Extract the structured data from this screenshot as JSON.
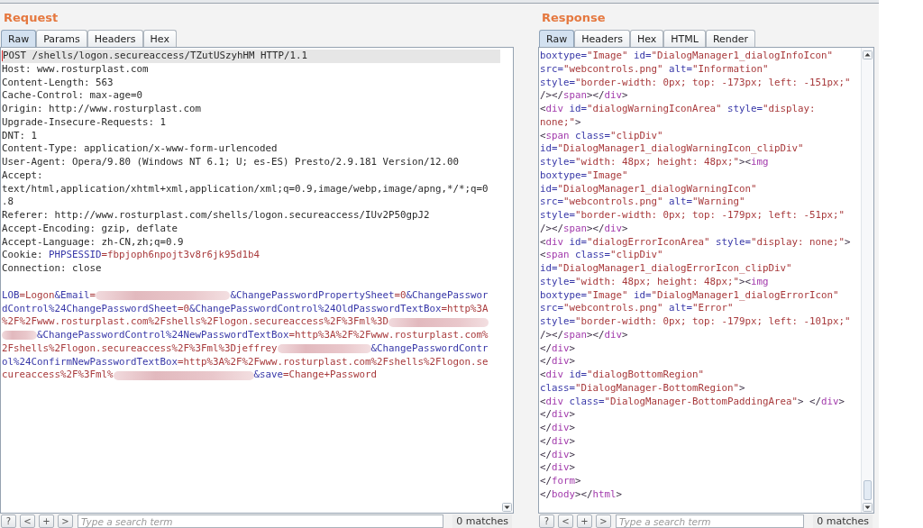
{
  "request": {
    "title": "Request",
    "tabs": [
      {
        "label": "Raw",
        "selected": true
      },
      {
        "label": "Params",
        "selected": false
      },
      {
        "label": "Headers",
        "selected": false
      },
      {
        "label": "Hex",
        "selected": false
      }
    ],
    "request_line": {
      "text": "POST /shells/logon.secureaccess/TZutUSzyhHM HTTP/1.1",
      "highlighted": true
    },
    "headers": [
      {
        "name": "Host:",
        "value": [
          {
            "kind": "plain",
            "text": "www.rosturplast.com"
          }
        ]
      },
      {
        "name": "Content-Length:",
        "value": [
          {
            "kind": "plain",
            "text": "563"
          }
        ]
      },
      {
        "name": "Cache-Control:",
        "value": [
          {
            "kind": "plain",
            "text": "max-age=0"
          }
        ]
      },
      {
        "name": "Origin:",
        "value": [
          {
            "kind": "plain",
            "text": "http://www.rosturplast.com"
          }
        ]
      },
      {
        "name": "Upgrade-Insecure-Requests:",
        "value": [
          {
            "kind": "plain",
            "text": "1"
          }
        ]
      },
      {
        "name": "DNT:",
        "value": [
          {
            "kind": "plain",
            "text": "1"
          }
        ]
      },
      {
        "name": "Content-Type:",
        "value": [
          {
            "kind": "plain",
            "text": "application/x-www-form-urlencoded"
          }
        ]
      },
      {
        "name": "User-Agent:",
        "value": [
          {
            "kind": "plain",
            "text": "Opera/9.80 (Windows NT 6.1; U; es-ES) Presto/2.9.181 Version/12.00"
          }
        ]
      },
      {
        "name": "Accept:",
        "value": [
          {
            "kind": "plain",
            "text": "text/html,application/xhtml+xml,application/xml;q=0.9,image/webp,image/apng,*/*;q=0.8"
          }
        ]
      },
      {
        "name": "Referer:",
        "value": [
          {
            "kind": "plain",
            "text": "http://www.rosturplast.com/shells/logon.secureaccess/IUv2P50gpJ2"
          }
        ]
      },
      {
        "name": "Accept-Encoding:",
        "value": [
          {
            "kind": "plain",
            "text": "gzip, deflate"
          }
        ]
      },
      {
        "name": "Accept-Language:",
        "value": [
          {
            "kind": "plain",
            "text": "zh-CN,zh;q=0.9"
          }
        ]
      },
      {
        "name": "Cookie:",
        "value": [
          {
            "kind": "name",
            "text": "PHPSESSID"
          },
          {
            "kind": "value",
            "text": "=fbpjoph6npojt3v8r6jk95d1b4"
          }
        ]
      },
      {
        "name": "Connection:",
        "value": [
          {
            "kind": "plain",
            "text": "close"
          }
        ]
      }
    ],
    "body": [
      [
        {
          "kind": "text",
          "tokens": [
            {
              "kind": "name",
              "text": "LOB"
            },
            {
              "kind": "value",
              "text": "=Logon"
            },
            {
              "kind": "name",
              "text": "&Email"
            },
            {
              "kind": "value",
              "text": "="
            }
          ]
        },
        {
          "kind": "redacted"
        },
        {
          "kind": "text",
          "tokens": [
            {
              "kind": "name",
              "text": "&ChangePasswordPropertySheet"
            },
            {
              "kind": "value",
              "text": "=0"
            },
            {
              "kind": "name",
              "text": "&ChangePasswor"
            }
          ]
        }
      ],
      [
        {
          "kind": "text",
          "tokens": [
            {
              "kind": "name",
              "text": "dControl%24ChangePasswordSheet"
            },
            {
              "kind": "value",
              "text": "=0"
            },
            {
              "kind": "name",
              "text": "&ChangePasswordControl%24OldPasswordTextBox"
            },
            {
              "kind": "value",
              "text": "=http%3A"
            }
          ]
        }
      ],
      [
        {
          "kind": "text",
          "tokens": [
            {
              "kind": "value",
              "text": "%2F%2Fwww.rosturplast.com%2Fshells%2Flogon.secureaccess%2F%3Fml%3D"
            }
          ]
        },
        {
          "kind": "redacted"
        }
      ],
      [
        {
          "kind": "redacted"
        },
        {
          "kind": "text",
          "tokens": [
            {
              "kind": "name",
              "text": "&ChangePasswordControl%24NewPasswordTextBox"
            },
            {
              "kind": "value",
              "text": "=http%3A%2F%2Fwww.rosturplast.com%"
            }
          ]
        }
      ],
      [
        {
          "kind": "text",
          "tokens": [
            {
              "kind": "value",
              "text": "2Fshells%2Flogon.secureaccess%2F%3Fml%3Djeffrey"
            }
          ]
        },
        {
          "kind": "redacted"
        },
        {
          "kind": "text",
          "tokens": [
            {
              "kind": "name",
              "text": "&ChangePasswordContr"
            }
          ]
        }
      ],
      [
        {
          "kind": "text",
          "tokens": [
            {
              "kind": "name",
              "text": "ol%24ConfirmNewPasswordTextBox"
            },
            {
              "kind": "value",
              "text": "=http%3A%2F%2Fwww.rosturplast.com%2Fshells%2Flogon.se"
            }
          ]
        }
      ],
      [
        {
          "kind": "text",
          "tokens": [
            {
              "kind": "value",
              "text": "cureaccess%2F%3Fml%"
            }
          ]
        },
        {
          "kind": "redacted"
        },
        {
          "kind": "text",
          "tokens": [
            {
              "kind": "name",
              "text": "&save"
            },
            {
              "kind": "value",
              "text": "=Change+Password"
            }
          ]
        }
      ]
    ],
    "search": {
      "buttons": [
        "?",
        "<",
        "+",
        ">"
      ],
      "placeholder": "Type a search term",
      "matches": "0 matches"
    }
  },
  "response": {
    "title": "Response",
    "tabs": [
      {
        "label": "Raw",
        "selected": true
      },
      {
        "label": "Headers",
        "selected": false
      },
      {
        "label": "Hex",
        "selected": false
      },
      {
        "label": "HTML",
        "selected": false
      },
      {
        "label": "Render",
        "selected": false
      }
    ],
    "lines": [
      [
        {
          "kind": "attr",
          "text": "boxtype="
        },
        {
          "kind": "value",
          "text": "\"Image\""
        },
        {
          "kind": "attr",
          "text": " id="
        },
        {
          "kind": "value",
          "text": "\"DialogManager1_dialogInfoIcon\""
        }
      ],
      [
        {
          "kind": "attr",
          "text": "src="
        },
        {
          "kind": "value",
          "text": "\"webcontrols.png\""
        },
        {
          "kind": "attr",
          "text": " alt="
        },
        {
          "kind": "value",
          "text": "\"Information\""
        }
      ],
      [
        {
          "kind": "attr",
          "text": "style="
        },
        {
          "kind": "value",
          "text": "\"border-width: 0px; top: -173px; left: -151px;\""
        }
      ],
      [
        {
          "kind": "punct",
          "text": "/></"
        },
        {
          "kind": "tag",
          "text": "span"
        },
        {
          "kind": "punct",
          "text": "></"
        },
        {
          "kind": "tag",
          "text": "div"
        },
        {
          "kind": "punct",
          "text": ">"
        }
      ],
      [
        {
          "kind": "punct",
          "text": "<"
        },
        {
          "kind": "tag",
          "text": "div"
        },
        {
          "kind": "attr",
          "text": " id="
        },
        {
          "kind": "value",
          "text": "\"dialogWarningIconArea\""
        },
        {
          "kind": "attr",
          "text": " style="
        },
        {
          "kind": "value",
          "text": "\"display:"
        }
      ],
      [
        {
          "kind": "value",
          "text": "none;\""
        },
        {
          "kind": "punct",
          "text": ">"
        }
      ],
      [
        {
          "kind": "punct",
          "text": "<"
        },
        {
          "kind": "tag",
          "text": "span"
        },
        {
          "kind": "attr",
          "text": " class="
        },
        {
          "kind": "value",
          "text": "\"clipDiv\""
        }
      ],
      [
        {
          "kind": "attr",
          "text": "id="
        },
        {
          "kind": "value",
          "text": "\"DialogManager1_dialogWarningIcon_clipDiv\""
        }
      ],
      [
        {
          "kind": "attr",
          "text": "style="
        },
        {
          "kind": "value",
          "text": "\"width: 48px; height: 48px;\""
        },
        {
          "kind": "punct",
          "text": "><"
        },
        {
          "kind": "tag",
          "text": "img"
        }
      ],
      [
        {
          "kind": "attr",
          "text": "boxtype="
        },
        {
          "kind": "value",
          "text": "\"Image\""
        }
      ],
      [
        {
          "kind": "attr",
          "text": "id="
        },
        {
          "kind": "value",
          "text": "\"DialogManager1_dialogWarningIcon\""
        }
      ],
      [
        {
          "kind": "attr",
          "text": "src="
        },
        {
          "kind": "value",
          "text": "\"webcontrols.png\""
        },
        {
          "kind": "attr",
          "text": " alt="
        },
        {
          "kind": "value",
          "text": "\"Warning\""
        }
      ],
      [
        {
          "kind": "attr",
          "text": "style="
        },
        {
          "kind": "value",
          "text": "\"border-width: 0px; top: -179px; left: -51px;\""
        }
      ],
      [
        {
          "kind": "punct",
          "text": "/></"
        },
        {
          "kind": "tag",
          "text": "span"
        },
        {
          "kind": "punct",
          "text": "></"
        },
        {
          "kind": "tag",
          "text": "div"
        },
        {
          "kind": "punct",
          "text": ">"
        }
      ],
      [
        {
          "kind": "punct",
          "text": "<"
        },
        {
          "kind": "tag",
          "text": "div"
        },
        {
          "kind": "attr",
          "text": " id="
        },
        {
          "kind": "value",
          "text": "\"dialogErrorIconArea\""
        },
        {
          "kind": "attr",
          "text": " style="
        },
        {
          "kind": "value",
          "text": "\"display: none;\""
        },
        {
          "kind": "punct",
          "text": ">"
        }
      ],
      [
        {
          "kind": "punct",
          "text": "<"
        },
        {
          "kind": "tag",
          "text": "span"
        },
        {
          "kind": "attr",
          "text": " class="
        },
        {
          "kind": "value",
          "text": "\"clipDiv\""
        }
      ],
      [
        {
          "kind": "attr",
          "text": "id="
        },
        {
          "kind": "value",
          "text": "\"DialogManager1_dialogErrorIcon_clipDiv\""
        }
      ],
      [
        {
          "kind": "attr",
          "text": "style="
        },
        {
          "kind": "value",
          "text": "\"width: 48px; height: 48px;\""
        },
        {
          "kind": "punct",
          "text": "><"
        },
        {
          "kind": "tag",
          "text": "img"
        }
      ],
      [
        {
          "kind": "attr",
          "text": "boxtype="
        },
        {
          "kind": "value",
          "text": "\"Image\""
        },
        {
          "kind": "attr",
          "text": " id="
        },
        {
          "kind": "value",
          "text": "\"DialogManager1_dialogErrorIcon\""
        }
      ],
      [
        {
          "kind": "attr",
          "text": "src="
        },
        {
          "kind": "value",
          "text": "\"webcontrols.png\""
        },
        {
          "kind": "attr",
          "text": " alt="
        },
        {
          "kind": "value",
          "text": "\"Error\""
        }
      ],
      [
        {
          "kind": "attr",
          "text": "style="
        },
        {
          "kind": "value",
          "text": "\"border-width: 0px; top: -179px; left: -101px;\""
        }
      ],
      [
        {
          "kind": "punct",
          "text": "/></"
        },
        {
          "kind": "tag",
          "text": "span"
        },
        {
          "kind": "punct",
          "text": "></"
        },
        {
          "kind": "tag",
          "text": "div"
        },
        {
          "kind": "punct",
          "text": ">"
        }
      ],
      [
        {
          "kind": "punct",
          "text": "</"
        },
        {
          "kind": "tag",
          "text": "div"
        },
        {
          "kind": "punct",
          "text": ">"
        }
      ],
      [
        {
          "kind": "punct",
          "text": "</"
        },
        {
          "kind": "tag",
          "text": "div"
        },
        {
          "kind": "punct",
          "text": ">"
        }
      ],
      [
        {
          "kind": "punct",
          "text": "<"
        },
        {
          "kind": "tag",
          "text": "div"
        },
        {
          "kind": "attr",
          "text": " id="
        },
        {
          "kind": "value",
          "text": "\"dialogBottomRegion\""
        }
      ],
      [
        {
          "kind": "attr",
          "text": "class="
        },
        {
          "kind": "value",
          "text": "\"DialogManager-BottomRegion\""
        },
        {
          "kind": "punct",
          "text": ">"
        }
      ],
      [
        {
          "kind": "punct",
          "text": "<"
        },
        {
          "kind": "tag",
          "text": "div"
        },
        {
          "kind": "attr",
          "text": " class="
        },
        {
          "kind": "value",
          "text": "\"DialogManager-BottomPaddingArea\""
        },
        {
          "kind": "punct",
          "text": "> </"
        },
        {
          "kind": "tag",
          "text": "div"
        },
        {
          "kind": "punct",
          "text": ">"
        }
      ],
      [
        {
          "kind": "punct",
          "text": "</"
        },
        {
          "kind": "tag",
          "text": "div"
        },
        {
          "kind": "punct",
          "text": ">"
        }
      ],
      [
        {
          "kind": "punct",
          "text": "</"
        },
        {
          "kind": "tag",
          "text": "div"
        },
        {
          "kind": "punct",
          "text": ">"
        }
      ],
      [
        {
          "kind": "punct",
          "text": "</"
        },
        {
          "kind": "tag",
          "text": "div"
        },
        {
          "kind": "punct",
          "text": ">"
        }
      ],
      [
        {
          "kind": "punct",
          "text": "</"
        },
        {
          "kind": "tag",
          "text": "div"
        },
        {
          "kind": "punct",
          "text": ">"
        }
      ],
      [
        {
          "kind": "punct",
          "text": "</"
        },
        {
          "kind": "tag",
          "text": "div"
        },
        {
          "kind": "punct",
          "text": ">"
        }
      ],
      [
        {
          "kind": "punct",
          "text": "</"
        },
        {
          "kind": "tag",
          "text": "form"
        },
        {
          "kind": "punct",
          "text": ">"
        }
      ],
      [
        {
          "kind": "punct",
          "text": "</"
        },
        {
          "kind": "tag",
          "text": "body"
        },
        {
          "kind": "punct",
          "text": "></"
        },
        {
          "kind": "tag",
          "text": "html"
        },
        {
          "kind": "punct",
          "text": ">"
        }
      ]
    ],
    "search": {
      "buttons": [
        "?",
        "<",
        "+",
        ">"
      ],
      "placeholder": "Type a search term",
      "matches": "0 matches"
    }
  }
}
